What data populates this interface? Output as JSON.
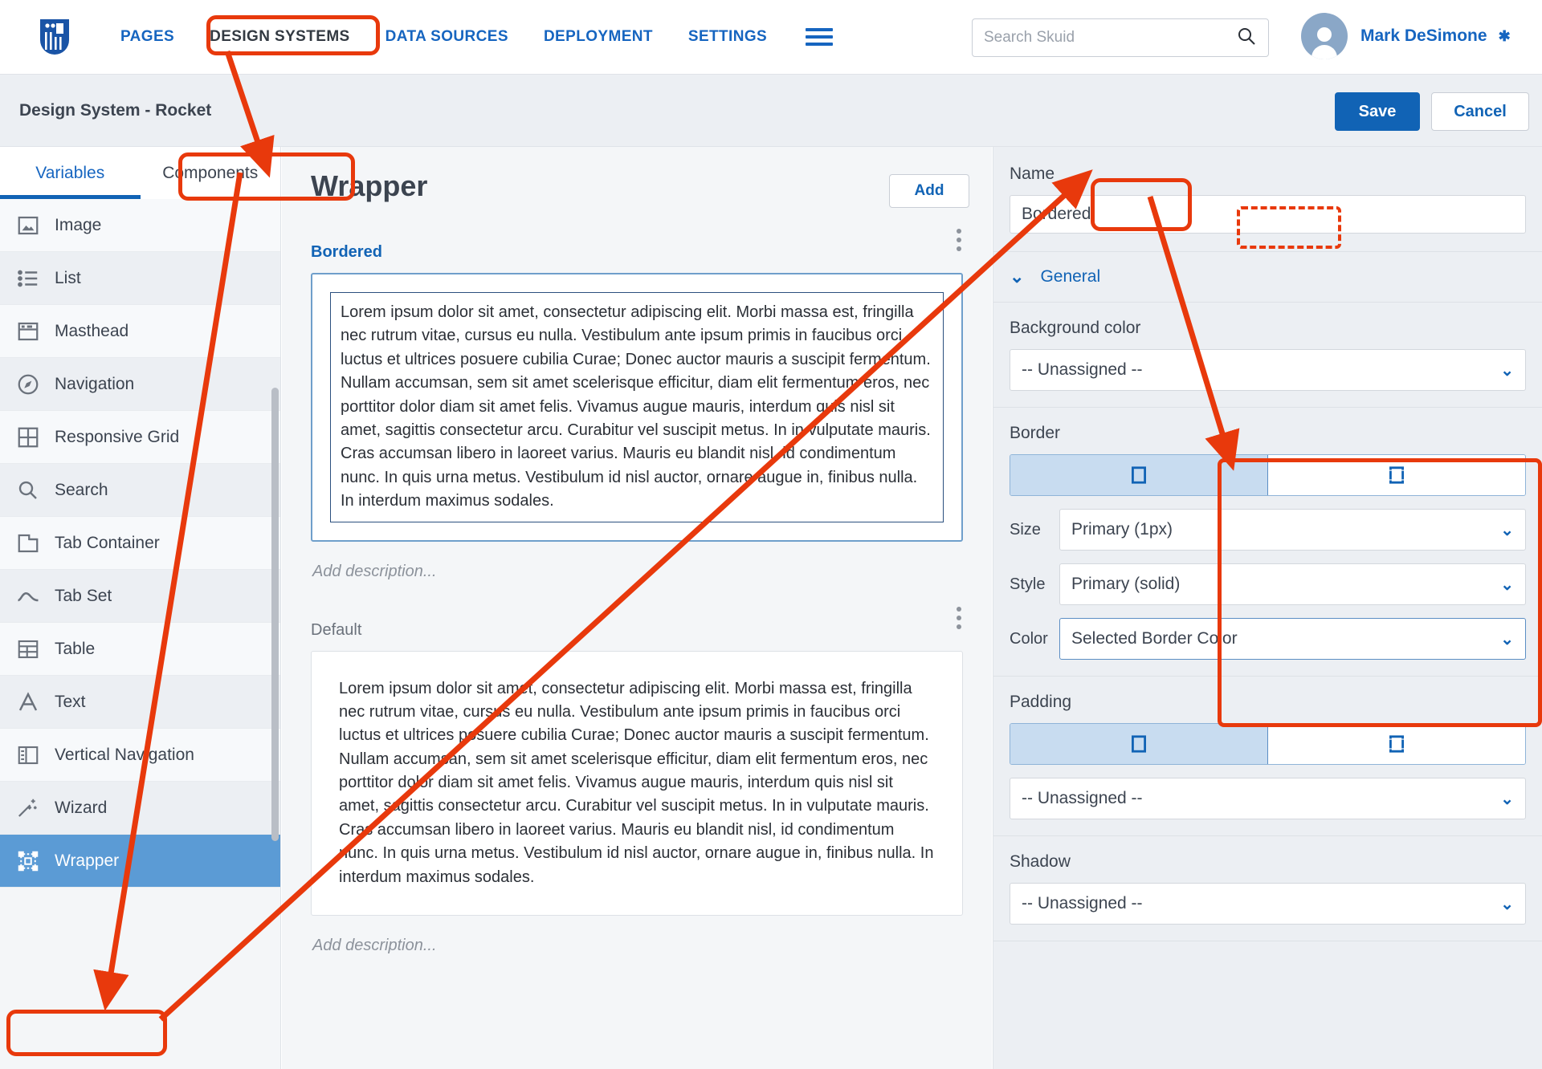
{
  "topnav": {
    "logo_icon": "skuid-logo-icon",
    "links": [
      {
        "label": "PAGES",
        "active": false
      },
      {
        "label": "DESIGN SYSTEMS",
        "active": true
      },
      {
        "label": "DATA SOURCES",
        "active": false
      },
      {
        "label": "DEPLOYMENT",
        "active": false
      },
      {
        "label": "SETTINGS",
        "active": false
      }
    ],
    "hamburger_icon": "hamburger-menu-icon",
    "search": {
      "placeholder": "Search Skuid",
      "value": "",
      "icon": "search-icon"
    },
    "user": {
      "name": "Mark DeSimone",
      "avatar_icon": "user-avatar-icon",
      "caret_icon": "chevron-down-icon"
    }
  },
  "subheader": {
    "title": "Design System - Rocket",
    "save_label": "Save",
    "cancel_label": "Cancel"
  },
  "leftpanel": {
    "tabs": [
      {
        "label": "Variables",
        "active": true
      },
      {
        "label": "Components",
        "active": false
      }
    ],
    "items": [
      {
        "label": "Image",
        "icon": "image-icon"
      },
      {
        "label": "List",
        "icon": "list-icon"
      },
      {
        "label": "Masthead",
        "icon": "masthead-icon"
      },
      {
        "label": "Navigation",
        "icon": "compass-navigation-icon"
      },
      {
        "label": "Responsive Grid",
        "icon": "grid-icon"
      },
      {
        "label": "Search",
        "icon": "search-icon"
      },
      {
        "label": "Tab Container",
        "icon": "tab-container-icon"
      },
      {
        "label": "Tab Set",
        "icon": "tab-set-icon"
      },
      {
        "label": "Table",
        "icon": "table-icon"
      },
      {
        "label": "Text",
        "icon": "text-a-icon"
      },
      {
        "label": "Vertical Navigation",
        "icon": "vertical-navigation-icon"
      },
      {
        "label": "Wizard",
        "icon": "wizard-wand-icon"
      },
      {
        "label": "Wrapper",
        "icon": "wrapper-icon",
        "selected": true
      }
    ]
  },
  "main": {
    "title": "Wrapper",
    "add_label": "Add",
    "lorem": "Lorem ipsum dolor sit amet, consectetur adipiscing elit. Morbi massa est, fringilla nec rutrum vitae, cursus eu nulla. Vestibulum ante ipsum primis in faucibus orci luctus et ultrices posuere cubilia Curae; Donec auctor mauris a suscipit fermentum. Nullam accumsan, sem sit amet scelerisque efficitur, diam elit fermentum eros, nec porttitor dolor diam sit amet felis. Vivamus augue mauris, interdum quis nisl sit amet, sagittis consectetur arcu. Curabitur vel suscipit metus. In in vulputate mauris. Cras accumsan libero in laoreet varius. Mauris eu blandit nisl, id condimentum nunc. In quis urna metus. Vestibulum id nisl auctor, ornare augue in, finibus nulla. In interdum maximus sodales.",
    "variants": [
      {
        "name": "Bordered",
        "description_placeholder": "Add description...",
        "kebab_icon": "kebab-menu-icon"
      },
      {
        "name": "Default",
        "description_placeholder": "Add description...",
        "kebab_icon": "kebab-menu-icon"
      }
    ]
  },
  "rightpanel": {
    "name_label": "Name",
    "name_value": "Bordered",
    "general_label": "General",
    "general_chevron_icon": "chevron-down-icon",
    "background_color_label": "Background color",
    "background_color_value": "-- Unassigned --",
    "border": {
      "label": "Border",
      "mode_all_icon": "border-all-sides-icon",
      "mode_individual_icon": "border-individual-sides-icon",
      "mode_selected": "all",
      "size_label": "Size",
      "size_value": "Primary (1px)",
      "style_label": "Style",
      "style_value": "Primary (solid)",
      "color_label": "Color",
      "color_value": "Selected Border Color"
    },
    "padding": {
      "label": "Padding",
      "mode_all_icon": "padding-all-sides-icon",
      "mode_individual_icon": "padding-individual-sides-icon",
      "mode_selected": "all",
      "value": "-- Unassigned --"
    },
    "shadow": {
      "label": "Shadow",
      "value": "-- Unassigned --"
    },
    "dropdown_chevron_icon": "chevron-down-icon"
  },
  "annotations": {
    "accent_color": "#e8390c",
    "callouts": [
      "design-systems-nav-highlight",
      "components-tab-highlight",
      "wrapper-item-highlight",
      "add-button-highlight",
      "name-field-highlight",
      "border-section-highlight"
    ]
  }
}
